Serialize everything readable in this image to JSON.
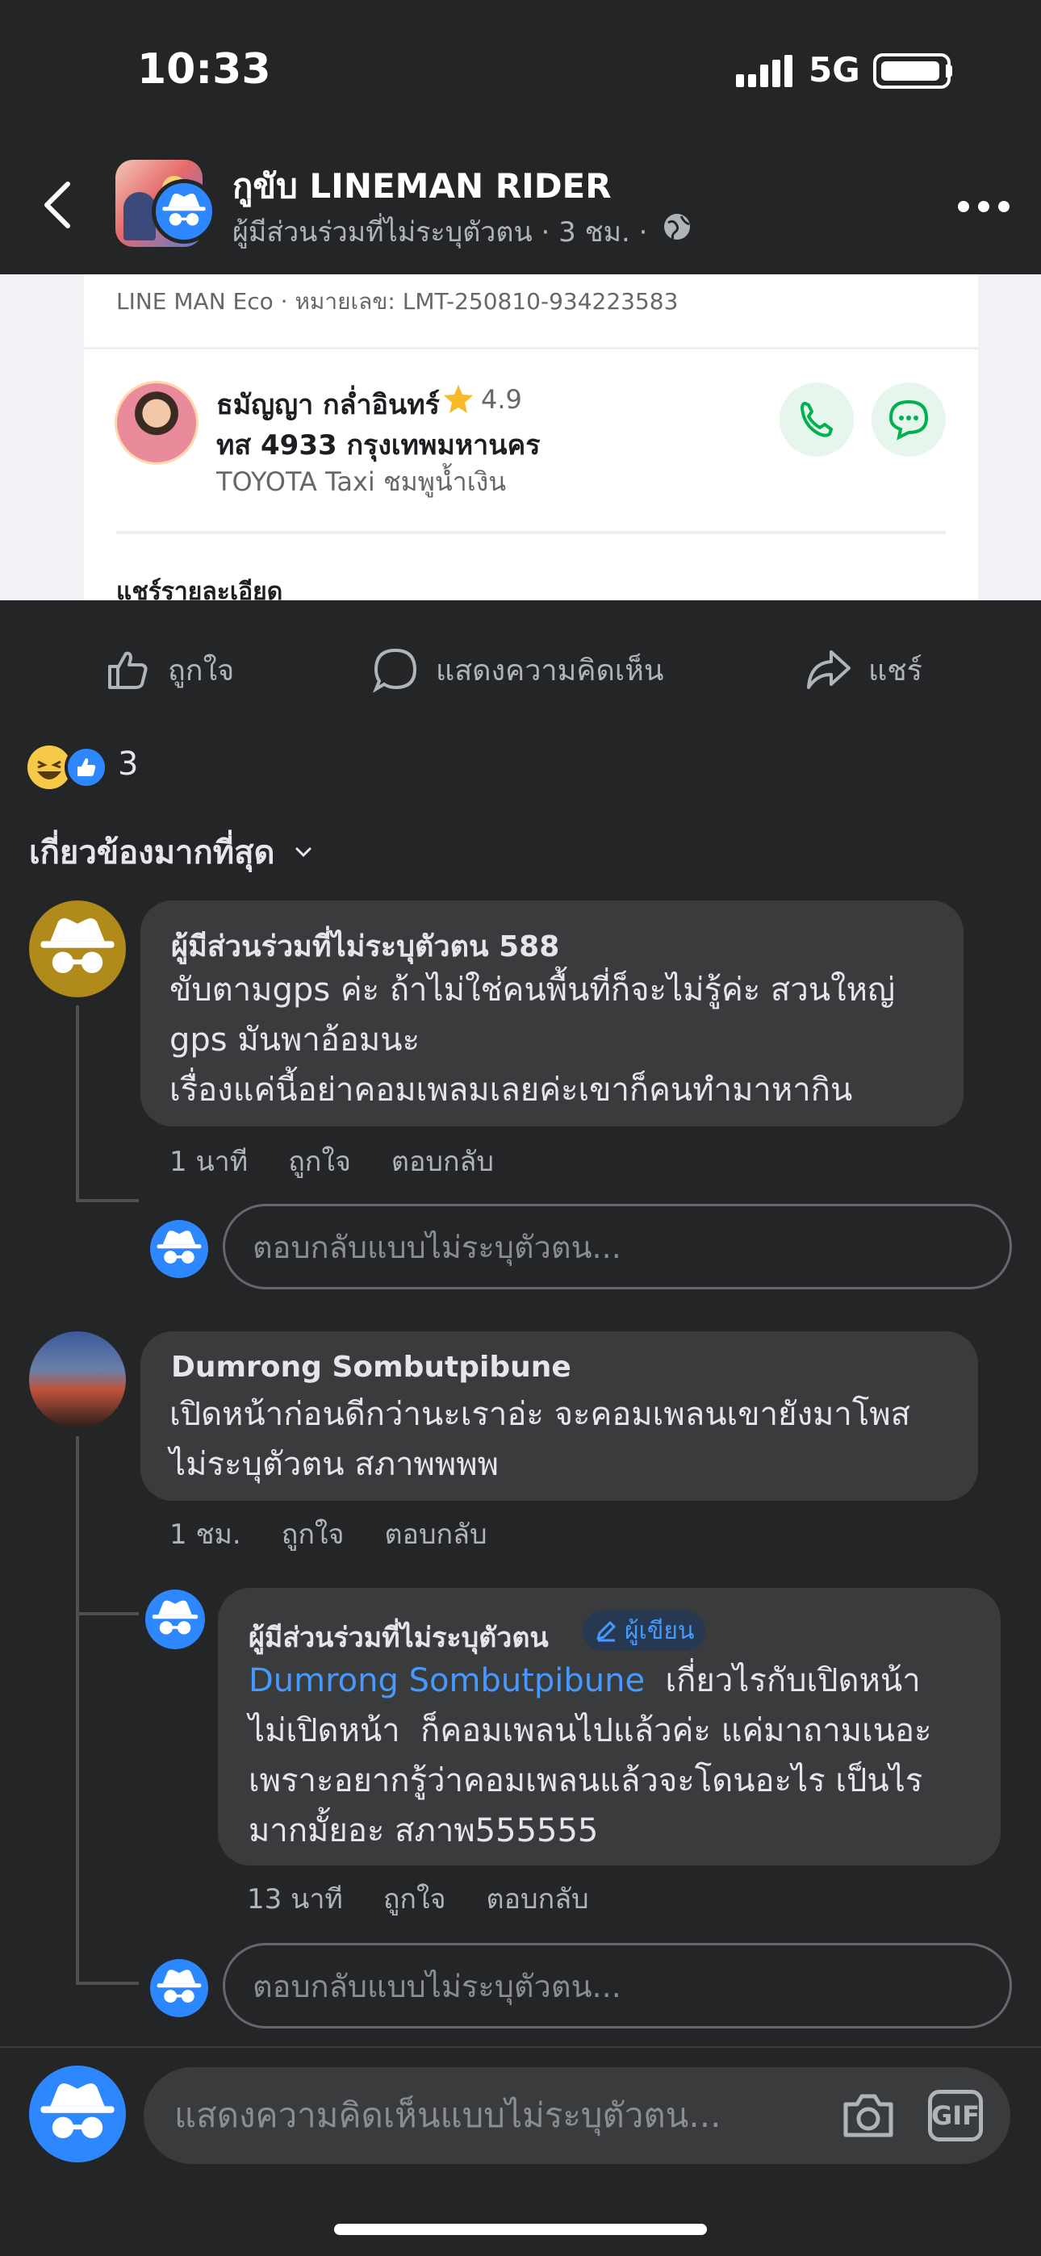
{
  "status_bar": {
    "time": "10:33",
    "network": "5G"
  },
  "header": {
    "title": "กูขับ LINEMAN RIDER",
    "subtitle": "ผู้มีส่วนร่วมที่ไม่ระบุตัวตน · 3 ชม. ·"
  },
  "post_image": {
    "order_id": "LINE MAN Eco · หมายเลข: LMT-250810-934223583",
    "driver_name": "ธมัญญา กล่ำอินทร์",
    "rating": "4.9",
    "plate": "ทส 4933 กรุงเทพมหานคร",
    "car": "TOYOTA Taxi ชมพูน้ำเงิน",
    "share_detail": "แชร์รายละเอียด"
  },
  "actions": {
    "like": "ถูกใจ",
    "comment": "แสดงความคิดเห็น",
    "share": "แชร์"
  },
  "reactions": {
    "count": "3"
  },
  "sort_label": "เกี่ยวข้องมากที่สุด",
  "comments": [
    {
      "author": "ผู้มีส่วนร่วมที่ไม่ระบุตัวตน 588",
      "lines": [
        "ขับตามgps ค่ะ ถ้าไม่ใช่คนพื้นที่ก็จะไม่รู้ค่ะ สวนใหญ่",
        "gps มันพาอ้อมนะ",
        "เรื่องแค่นี้อย่าคอมเพลมเลยค่ะเขาก็คนทำมาหากิน"
      ],
      "time": "1 นาที",
      "like": "ถูกใจ",
      "reply": "ตอบกลับ"
    },
    {
      "author": "Dumrong Sombutpibune",
      "lines": [
        "เปิดหน้าก่อนดีกว่านะเราอ่ะ จะคอมเพลนเขายังมาโพส",
        "ไม่ระบุตัวตน สภาพพพพ"
      ],
      "time": "1 ชม.",
      "like": "ถูกใจ",
      "reply": "ตอบกลับ"
    }
  ],
  "reply": {
    "author": "ผู้มีส่วนร่วมที่ไม่ระบุตัวตน",
    "badge": "ผู้เขียน",
    "mention": "Dumrong Sombutpibune",
    "line1_rest": "  เกี่ยวไรกับเปิดหน้า",
    "lines": [
      "ไม่เปิดหน้า  ก็คอมเพลนไปแล้วค่ะ แค่มาถามเนอะ",
      "เพราะอยากรู้ว่าคอมเพลนแล้วจะโดนอะไร เป็นไร",
      "มากมั้ยอะ สภาพ555555"
    ],
    "time": "13 นาที",
    "like": "ถูกใจ",
    "reply": "ตอบกลับ"
  },
  "reply_placeholder": "ตอบกลับแบบไม่ระบุตัวตน...",
  "composer": {
    "placeholder": "แสดงความคิดเห็นแบบไม่ระบุตัวตน...",
    "gif": "GIF"
  },
  "colors": {
    "background": "#242526",
    "bubble": "#3a3b3c",
    "accent": "#2d88ff",
    "link": "#4599ff"
  },
  "icons": [
    "back-icon",
    "more-icon",
    "globe-icon",
    "like-icon",
    "comment-icon",
    "share-icon",
    "phone-icon",
    "chat-icon",
    "star-icon",
    "incognito-icon",
    "camera-icon",
    "chevron-down-icon"
  ]
}
